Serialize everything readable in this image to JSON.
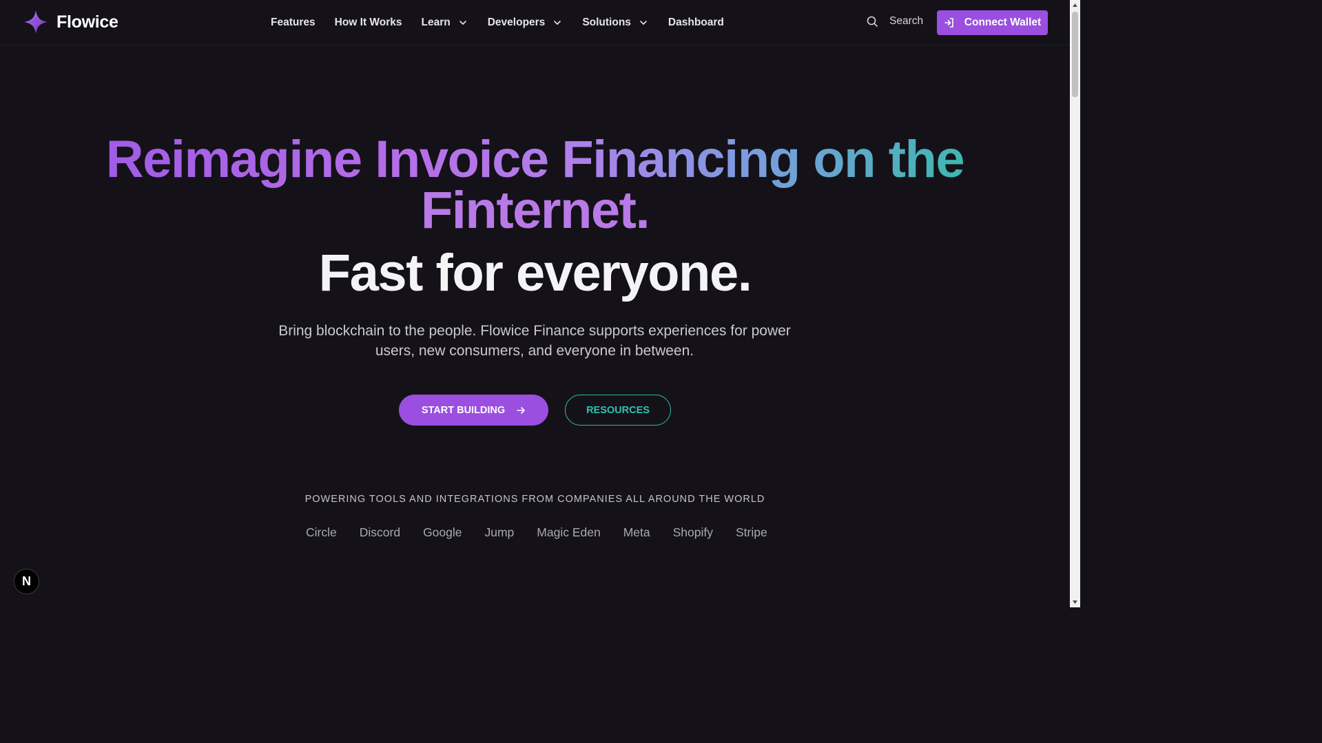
{
  "header": {
    "brand": "Flowice",
    "nav": {
      "features": "Features",
      "how_it_works": "How It Works",
      "learn": "Learn",
      "developers": "Developers",
      "solutions": "Solutions",
      "dashboard": "Dashboard"
    },
    "search_label": "Search",
    "connect_wallet": "Connect Wallet"
  },
  "hero": {
    "title_part1": "Reimagine Invoice Financing on the",
    "title_part2": "Finternet.",
    "subtitle": "Fast for everyone.",
    "description": "Bring blockchain to the people. Flowice Finance supports experiences for power users, new consumers, and everyone in between.",
    "start_building": "START BUILDING",
    "resources": "RESOURCES"
  },
  "partners": {
    "heading": "POWERING TOOLS AND INTEGRATIONS FROM COMPANIES ALL AROUND THE WORLD",
    "companies": [
      "Circle",
      "Discord",
      "Google",
      "Jump",
      "Magic Eden",
      "Meta",
      "Shopify",
      "Stripe"
    ]
  },
  "badge": "N",
  "colors": {
    "background": "#141218",
    "accent_purple": "#9a4fe0",
    "accent_teal": "#2fc3b0"
  }
}
